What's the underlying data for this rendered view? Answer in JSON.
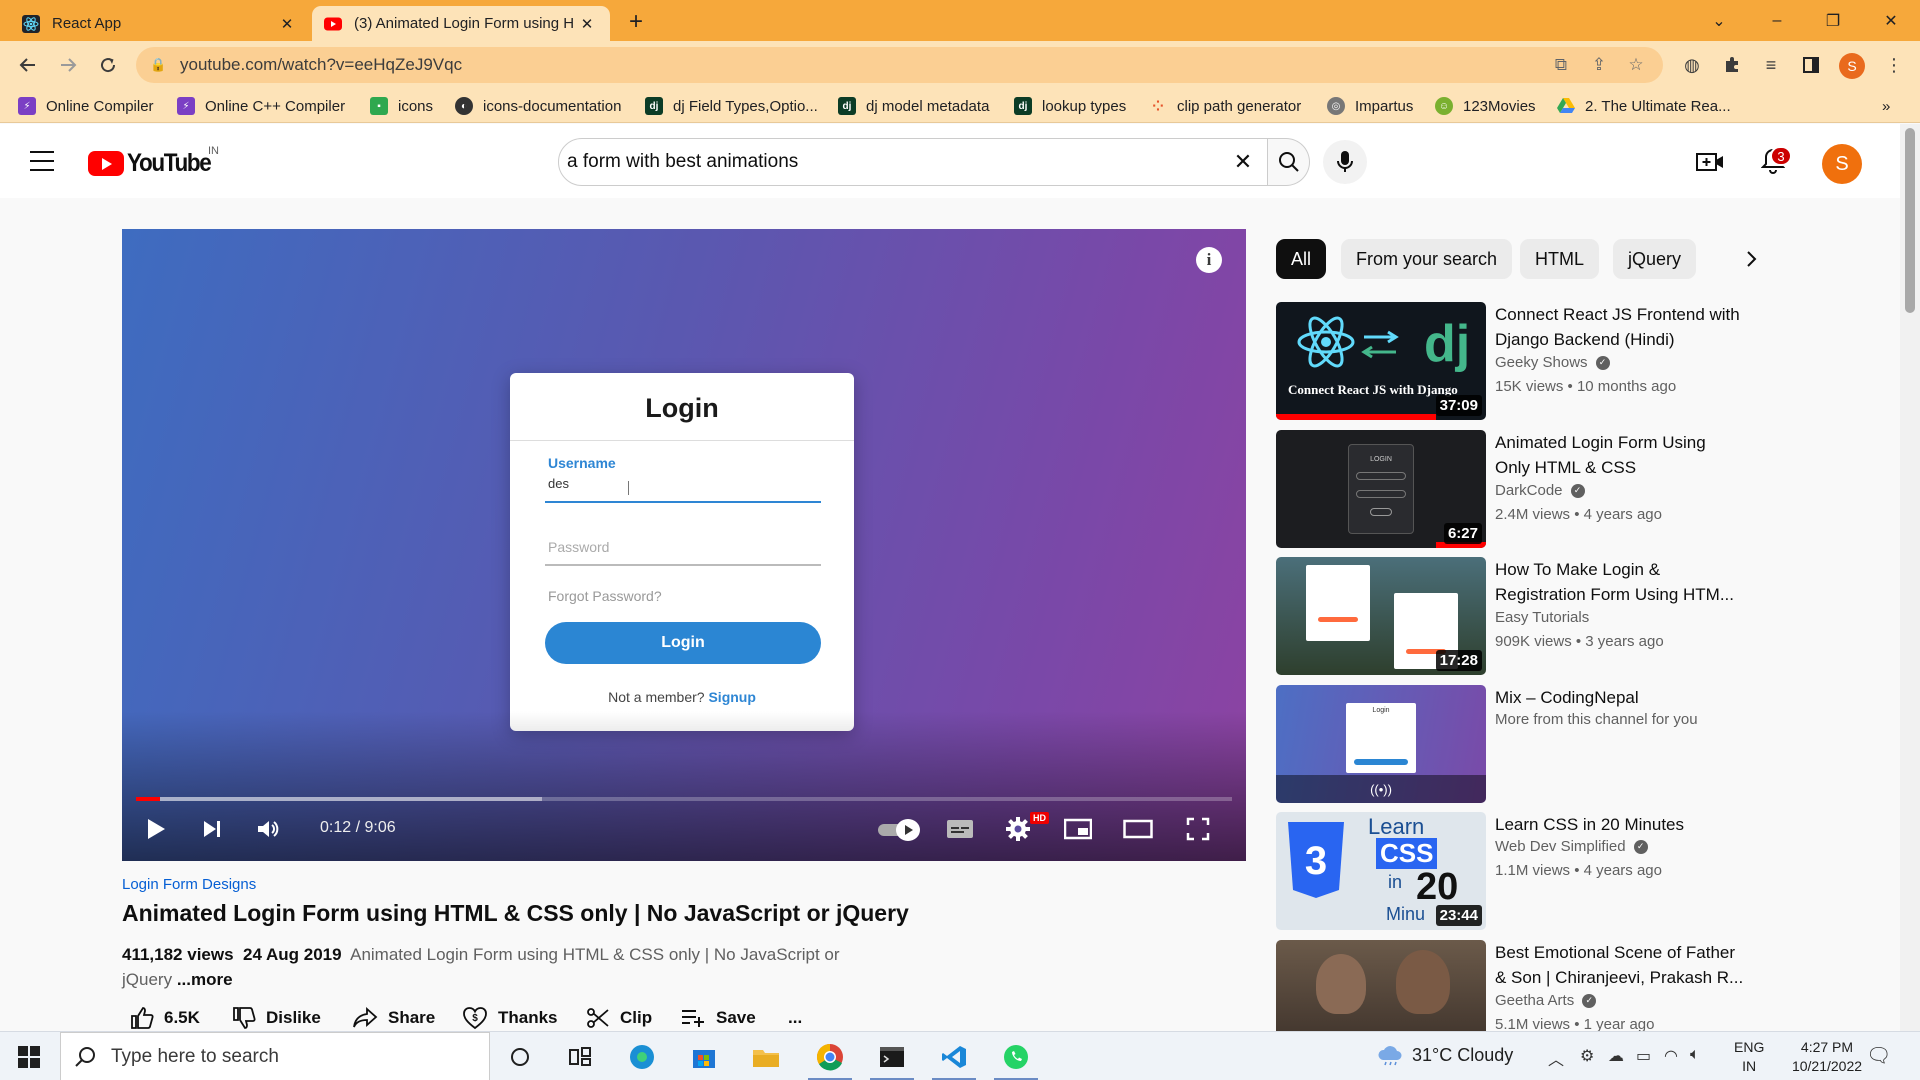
{
  "browser": {
    "tabs": [
      {
        "title": "React App"
      },
      {
        "title": "(3) Animated Login Form using H"
      }
    ],
    "new_tab": "+",
    "address": "youtube.com/watch?v=eeHqZeJ9Vqc",
    "profile_initial": "S",
    "bookmarks": [
      "Online Compiler",
      "Online C++ Compiler",
      "icons",
      "icons-documentation",
      "dj Field Types,Optio...",
      "dj model metadata",
      "lookup types",
      "clip path generator",
      "Impartus",
      "123Movies",
      "2. The Ultimate Rea..."
    ],
    "bookmark_overflow": "»",
    "bookmark_badge": "dj"
  },
  "youtube": {
    "logo_text": "YouTube",
    "country": "IN",
    "search_query": "a form with best animations",
    "notification_count": "3",
    "avatar_initial": "S"
  },
  "player": {
    "info_glyph": "i",
    "login_card": {
      "title": "Login",
      "username_label": "Username",
      "username_value": "des",
      "password_placeholder": "Password",
      "forgot": "Forgot Password?",
      "button": "Login",
      "signup_prompt": "Not a member?",
      "signup_link": "Signup"
    },
    "time": "0:12 / 9:06",
    "progress_played": 0.022,
    "progress_buffered": 0.37,
    "hd_badge": "HD"
  },
  "video": {
    "channel_tag": "Login Form Designs",
    "title": "Animated Login Form using HTML & CSS only | No JavaScript or jQuery",
    "views": "411,182 views",
    "date": "24 Aug 2019",
    "description": "Animated Login Form using HTML & CSS only | No JavaScript or jQuery",
    "more": "...more",
    "actions": {
      "like_count": "6.5K",
      "dislike": "Dislike",
      "share": "Share",
      "thanks": "Thanks",
      "clip": "Clip",
      "save": "Save",
      "more": "..."
    }
  },
  "sidebar": {
    "chips": [
      "All",
      "From your search",
      "HTML",
      "jQuery"
    ],
    "recommendations": [
      {
        "title": "Connect React JS Frontend with Django Backend (Hindi)",
        "channel": "Geeky Shows",
        "verified": true,
        "meta": "15K views • 10 months ago",
        "duration": "37:09",
        "thumb_text": "Connect React JS with Django",
        "thumb_logo": "dj"
      },
      {
        "title": "Animated Login Form Using Only HTML & CSS",
        "channel": "DarkCode",
        "verified": true,
        "meta": "2.4M views • 4 years ago",
        "duration": "6:27",
        "thumb_text": "LOGIN"
      },
      {
        "title": "How To Make Login & Registration Form Using HTM...",
        "channel": "Easy Tutorials",
        "verified": false,
        "meta": "909K views • 3 years ago",
        "duration": "17:28"
      },
      {
        "title": "Mix – CodingNepal",
        "channel": "More from this channel for you",
        "verified": false,
        "meta": "",
        "duration": "",
        "thumb_text": "Login",
        "mix_icon": "((•))"
      },
      {
        "title": "Learn CSS in 20 Minutes",
        "channel": "Web Dev Simplified",
        "verified": true,
        "meta": "1.1M views • 4 years ago",
        "duration": "23:44",
        "thumb_line1": "Learn",
        "thumb_line2": "CSS",
        "thumb_line3": "in",
        "thumb_line4": "20",
        "thumb_line5": "Minu",
        "thumb_badge": "3"
      },
      {
        "title": "Best Emotional Scene of Father & Son | Chiranjeevi, Prakash R...",
        "channel": "Geetha Arts",
        "verified": true,
        "meta": "5.1M views • 1 year ago",
        "duration": ""
      }
    ]
  },
  "taskbar": {
    "search_placeholder": "Type here to search",
    "weather": "31°C  Cloudy",
    "lang1": "ENG",
    "lang2": "IN",
    "time": "4:27 PM",
    "date": "10/21/2022"
  },
  "colors": {
    "tab_strip": "#f6a83b",
    "toolbar": "#fde3b8",
    "yt_red": "#ff0000",
    "link_blue": "#065fd4",
    "avatar_orange": "#f0700d"
  }
}
